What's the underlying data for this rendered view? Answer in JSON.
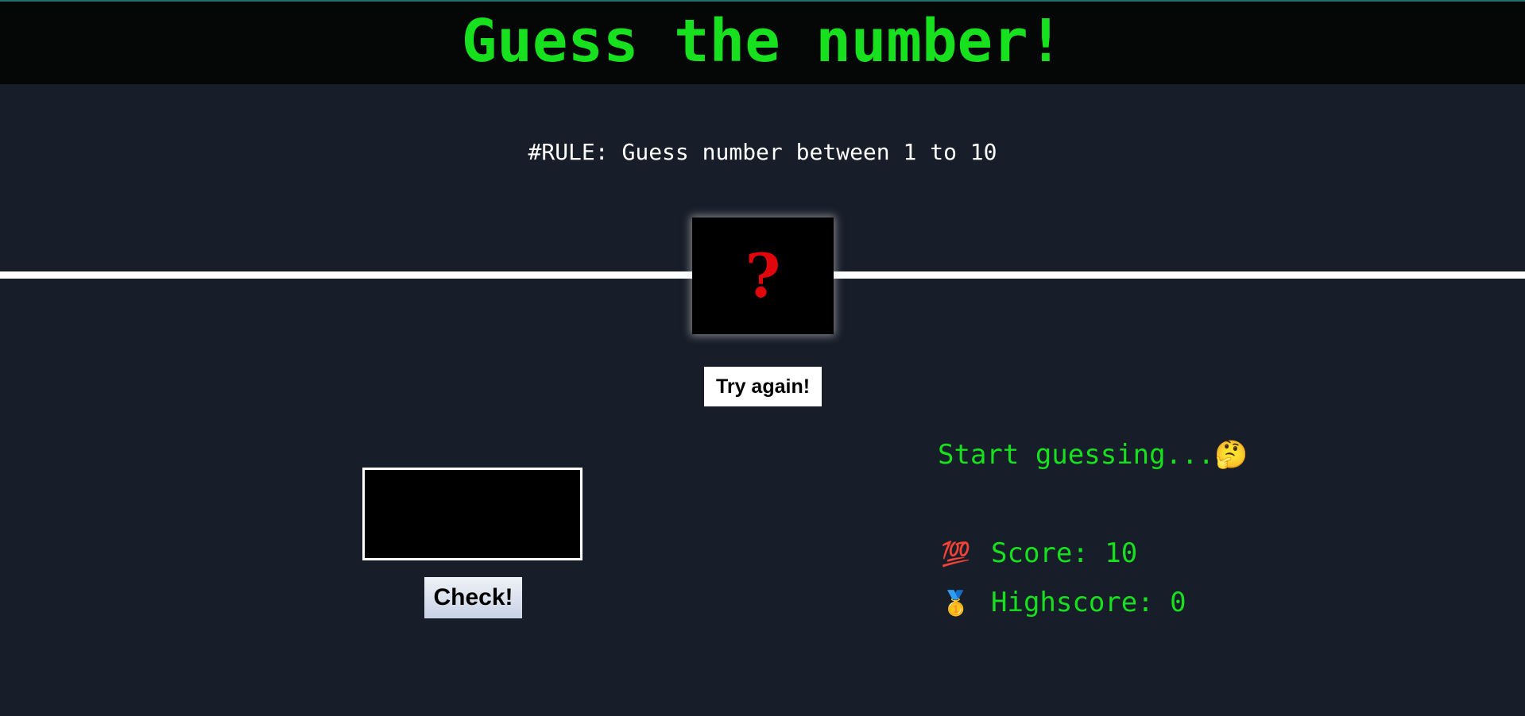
{
  "header": {
    "title": "Guess the number!"
  },
  "rule": "#RULE: Guess number between 1 to 10",
  "secret": {
    "display": "?"
  },
  "buttons": {
    "try_again": "Try again!",
    "check": "Check!"
  },
  "input": {
    "value": ""
  },
  "status": {
    "message": "Start guessing...🤔"
  },
  "stats": {
    "score_icon": "💯",
    "score_label": "Score: 10",
    "highscore_icon": "🥇",
    "highscore_label": "Highscore: 0"
  },
  "colors": {
    "accent_green": "#17e01f",
    "question_red": "#e0060b",
    "background": "#181e29",
    "header_bg": "#050606"
  }
}
